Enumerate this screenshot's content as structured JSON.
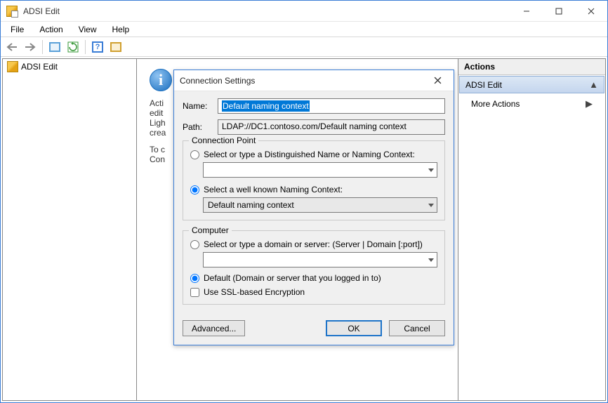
{
  "window": {
    "title": "ADSI Edit"
  },
  "menu": {
    "file": "File",
    "action": "Action",
    "view": "View",
    "help": "Help"
  },
  "tree": {
    "root": "ADSI Edit"
  },
  "content": {
    "line1": "Acti",
    "line2": "edit",
    "line3": "Ligh",
    "line4": "crea",
    "line5": "To c",
    "line6": "Con"
  },
  "actions": {
    "header": "Actions",
    "group": "ADSI Edit",
    "more": "More Actions"
  },
  "dialog": {
    "title": "Connection Settings",
    "name_label": "Name:",
    "name_value": "Default naming context",
    "path_label": "Path:",
    "path_value": "LDAP://DC1.contoso.com/Default naming context",
    "cp_legend": "Connection Point",
    "cp_radio1": "Select or type a Distinguished Name or Naming Context:",
    "cp_radio2": "Select a well known Naming Context:",
    "cp_value": "Default naming context",
    "comp_legend": "Computer",
    "comp_radio1": "Select or type a domain or server: (Server | Domain [:port])",
    "comp_radio2": "Default (Domain or server that you logged in to)",
    "ssl": "Use SSL-based Encryption",
    "advanced": "Advanced...",
    "ok": "OK",
    "cancel": "Cancel"
  }
}
